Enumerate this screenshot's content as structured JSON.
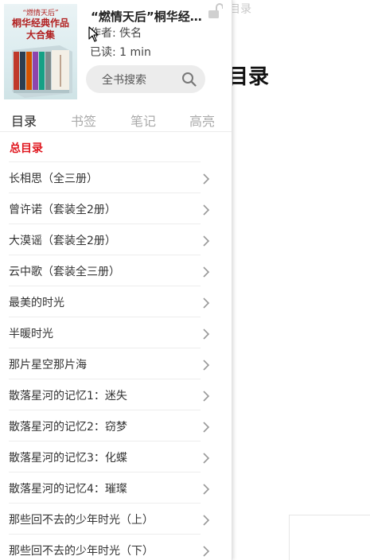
{
  "background": {
    "breadcrumb": "目录",
    "heading": "目录"
  },
  "book": {
    "title": "“燃情天后”桐华经典作品大合集",
    "author": "作者: 佚名",
    "read_time": "已读: 1  min",
    "cover_icon": "book-cover-image",
    "cover_text": [
      "“燃情天后”",
      "桐华经典作品",
      "大合集"
    ]
  },
  "search": {
    "label": "全书搜索"
  },
  "tabs": [
    {
      "label": "目录",
      "active": true
    },
    {
      "label": "书签",
      "active": false
    },
    {
      "label": "笔记",
      "active": false
    },
    {
      "label": "高亮",
      "active": false
    }
  ],
  "toc": {
    "heading": "总目录",
    "items": [
      "长相思（全三册）",
      "曾许诺（套装全2册）",
      "大漠谣（套装全2册）",
      "云中歌（套装全三册）",
      "最美的时光",
      "半暖时光",
      "那片星空那片海",
      "散落星河的记忆1：迷失",
      "散落星河的记忆2：窃梦",
      "散落星河的记忆3：化蝶",
      "散落星河的记忆4：璀璨",
      "那些回不去的少年时光（上）",
      "那些回不去的少年时光（下）"
    ]
  },
  "colors": {
    "accent_red": "#e0161e",
    "active_tab": "#222222",
    "inactive_tab": "#aaaaaa",
    "search_bg": "#ececec"
  }
}
